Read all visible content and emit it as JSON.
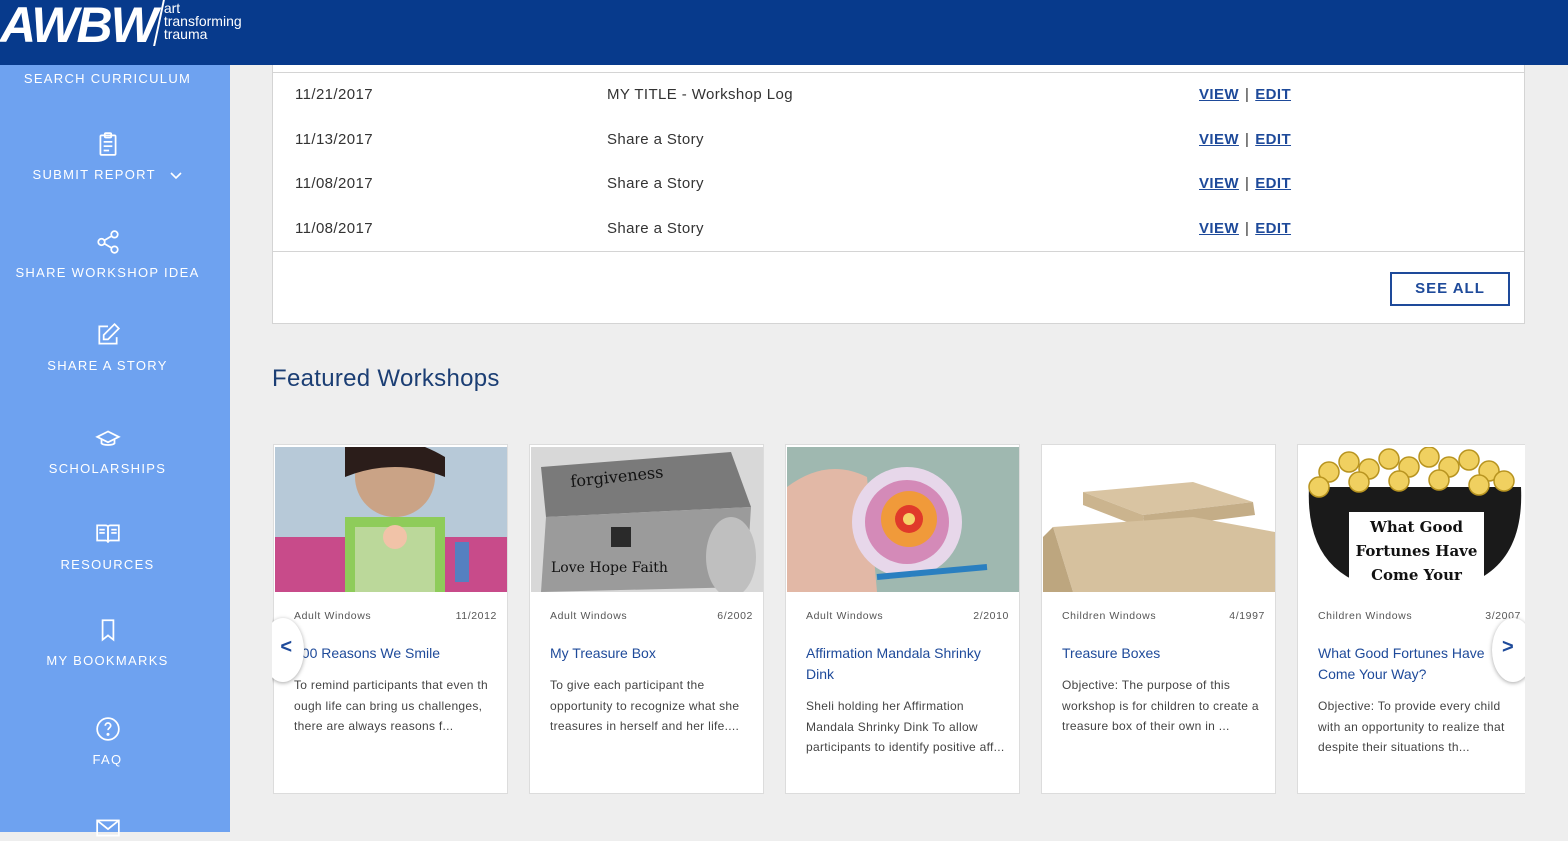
{
  "header": {
    "logo_mark": "AWBW",
    "logo_line1": "art",
    "logo_line2": "transforming",
    "logo_line3": "trauma"
  },
  "sidebar": {
    "items": [
      {
        "label": "Search Curriculum",
        "icon": "search-icon"
      },
      {
        "label": "Submit Report",
        "icon": "clipboard-icon"
      },
      {
        "label": "Share Workshop Idea",
        "icon": "share-icon"
      },
      {
        "label": "Share a Story",
        "icon": "edit-icon"
      },
      {
        "label": "Scholarships",
        "icon": "graduation-cap-icon"
      },
      {
        "label": "Resources",
        "icon": "book-icon"
      },
      {
        "label": "My Bookmarks",
        "icon": "bookmark-icon"
      },
      {
        "label": "FAQ",
        "icon": "question-icon"
      },
      {
        "label": "",
        "icon": "mail-icon"
      }
    ]
  },
  "log": {
    "rows": [
      {
        "date": "11/21/2017",
        "title": "MY TITLE - Workshop Log",
        "view": "VIEW",
        "sep": "|",
        "edit": "EDIT"
      },
      {
        "date": "11/13/2017",
        "title": "Share a Story",
        "view": "VIEW",
        "sep": "|",
        "edit": "EDIT"
      },
      {
        "date": "11/08/2017",
        "title": "Share a Story",
        "view": "VIEW",
        "sep": "|",
        "edit": "EDIT"
      },
      {
        "date": "11/08/2017",
        "title": "Share a Story",
        "view": "VIEW",
        "sep": "|",
        "edit": "EDIT"
      }
    ],
    "see_all": "SEE ALL"
  },
  "featured": {
    "title": "Featured Workshops",
    "prev": "<",
    "next": ">",
    "cards": [
      {
        "category": "Adult Windows",
        "date": "11/2012",
        "title": "100 Reasons We Smile",
        "desc": "To remind participants that even th ough life can bring us challenges, there are always reasons f..."
      },
      {
        "category": "Adult Windows",
        "date": "6/2002",
        "title": "My Treasure Box",
        "desc": "To give each participant the opportunity to recognize what she treasures in herself and her life...."
      },
      {
        "category": "Adult Windows",
        "date": "2/2010",
        "title": "Affirmation Mandala Shrinky Dink",
        "desc": "Sheli holding her Affirmation Mandala Shrinky Dink To allow participants to identify positive aff..."
      },
      {
        "category": "Children Windows",
        "date": "4/1997",
        "title": "Treasure Boxes",
        "desc": "Objective: The purpose of this workshop is for children to create a treasure box of their own in ..."
      },
      {
        "category": "Children Windows",
        "date": "3/2007",
        "title": "What Good Fortunes Have Come Your Way?",
        "desc": "Objective: To provide every child with an opportunity to realize that despite their situations th...",
        "img_text": [
          "What Good",
          "Fortunes Have",
          "Come Your"
        ]
      }
    ]
  },
  "accent_color": "#073a8c",
  "sidebar_color": "#6ea2f0",
  "link_color": "#1e4a9a"
}
